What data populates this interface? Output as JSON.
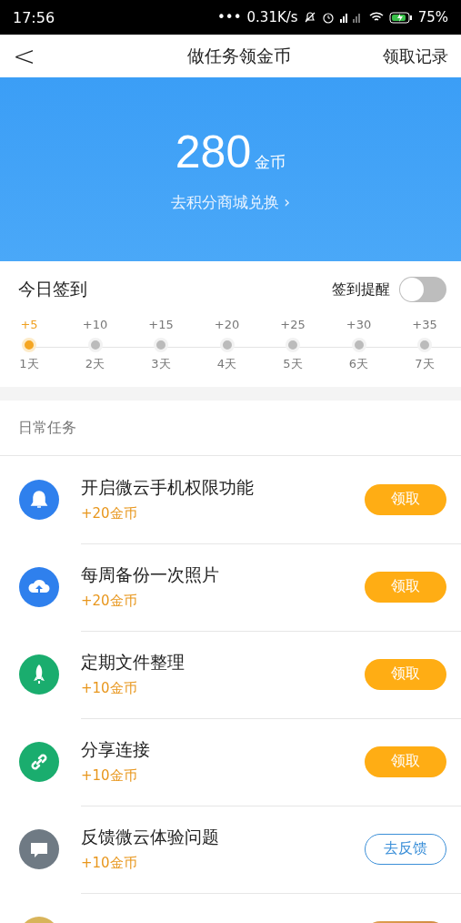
{
  "status_bar": {
    "time": "17:56",
    "dots": "•••",
    "speed": "0.31K/s",
    "battery": "75%"
  },
  "nav": {
    "back": "<",
    "title": "做任务领金币",
    "action": "领取记录"
  },
  "banner": {
    "amount": "280",
    "unit": "金币",
    "link": "去积分商城兑换",
    "chevron": "›"
  },
  "signin": {
    "title": "今日签到",
    "reminder_label": "签到提醒",
    "reminder_on": false,
    "days": [
      {
        "bonus": "+5",
        "day": "1天",
        "selected": true
      },
      {
        "bonus": "+10",
        "day": "2天",
        "selected": false
      },
      {
        "bonus": "+15",
        "day": "3天",
        "selected": false
      },
      {
        "bonus": "+20",
        "day": "4天",
        "selected": false
      },
      {
        "bonus": "+25",
        "day": "5天",
        "selected": false
      },
      {
        "bonus": "+30",
        "day": "6天",
        "selected": false
      },
      {
        "bonus": "+35",
        "day": "7天",
        "selected": false
      }
    ]
  },
  "tasks_header": "日常任务",
  "tasks": [
    {
      "color": "#2f80ed",
      "title": "开启微云手机权限功能",
      "reward": "+20金币",
      "button": "领取",
      "kind": "claim"
    },
    {
      "color": "#2f80ed",
      "title": "每周备份一次照片",
      "reward": "+20金币",
      "button": "领取",
      "kind": "claim"
    },
    {
      "color": "#1aad6e",
      "title": "定期文件整理",
      "reward": "+10金币",
      "button": "领取",
      "kind": "claim"
    },
    {
      "color": "#1aad6e",
      "title": "分享连接",
      "reward": "+10金币",
      "button": "领取",
      "kind": "claim"
    },
    {
      "color": "#6f7a84",
      "title": "反馈微云体验问题",
      "reward": "+10金币",
      "button": "去反馈",
      "kind": "outline"
    },
    {
      "color": "#d8b45a",
      "kind": "premium"
    }
  ]
}
